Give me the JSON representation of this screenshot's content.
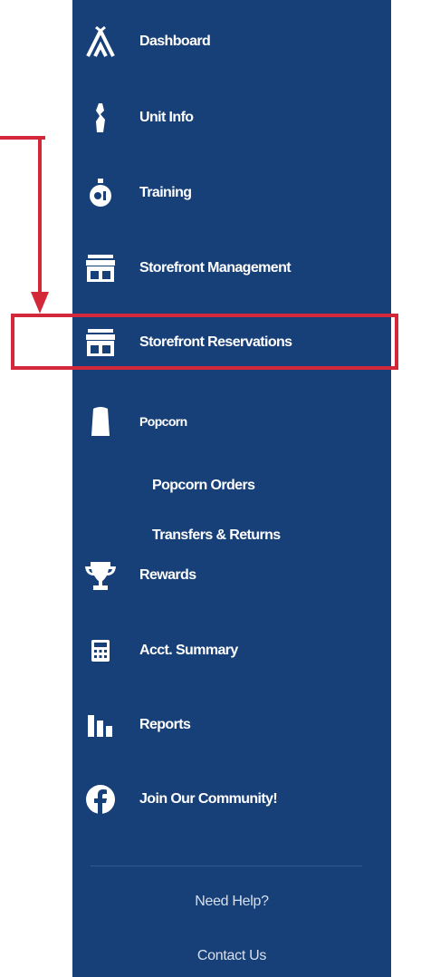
{
  "nav": {
    "items": [
      {
        "label": "Dashboard",
        "icon": "tent-icon"
      },
      {
        "label": "Unit Info",
        "icon": "knot-icon"
      },
      {
        "label": "Training",
        "icon": "training-icon"
      },
      {
        "label": "Storefront Management",
        "icon": "storefront-icon"
      },
      {
        "label": "Storefront Reservations",
        "icon": "storefront-icon"
      },
      {
        "label": "Popcorn",
        "icon": "popcorn-icon"
      },
      {
        "label": "Rewards",
        "icon": "trophy-icon"
      },
      {
        "label": "Acct. Summary",
        "icon": "calculator-icon"
      },
      {
        "label": "Reports",
        "icon": "bar-chart-icon"
      },
      {
        "label": "Join Our Community!",
        "icon": "facebook-icon"
      }
    ],
    "popcorn_sub": [
      "Popcorn Orders",
      "Transfers & Returns"
    ]
  },
  "footer": {
    "help": "Need Help?",
    "contact": "Contact Us"
  },
  "colors": {
    "sidebar": "#173f78",
    "highlight": "#d2283a",
    "text": "#ffffff"
  }
}
